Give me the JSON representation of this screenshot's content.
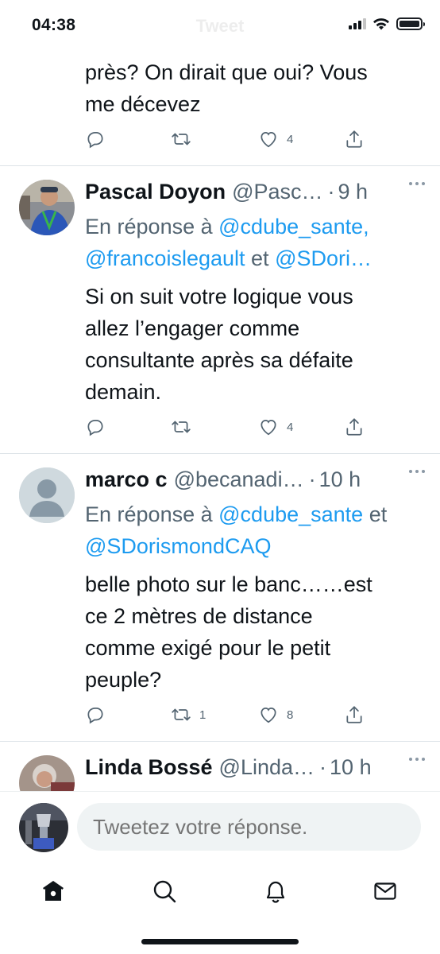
{
  "status_bar": {
    "time": "04:38",
    "ghost_title": "Tweet"
  },
  "previous_tweet": {
    "text_line1": "près? On dirait que oui? Vous",
    "text_line2": "me décevez",
    "actions": {
      "reply_count": "",
      "retweet_count": "",
      "like_count": "4"
    }
  },
  "tweets": [
    {
      "name": "Pascal Doyon",
      "handle": "@Pasc…",
      "time": "9 h",
      "reply_prefix": "En réponse à",
      "reply_mentions_line1": "@cdube_sante,",
      "reply_mentions_line2a": "@francoislegault",
      "reply_connector": "et",
      "reply_mentions_line2b": "@SDori…",
      "text_lines": [
        "Si on suit votre logique vous",
        "allez l’engager comme",
        "consultante après sa défaite",
        "demain."
      ],
      "actions": {
        "reply_count": "",
        "retweet_count": "",
        "like_count": "4"
      }
    },
    {
      "name": "marco c",
      "handle": "@becanadi…",
      "time": "10 h",
      "reply_prefix": "En réponse à",
      "reply_mentions_line1": "@cdube_sante",
      "reply_connector": "et",
      "reply_mentions_line2a": "@SDorismondCAQ",
      "text_lines": [
        "belle photo sur le banc……est",
        "ce 2 mètres de distance",
        "comme exigé pour le petit",
        "peuple?"
      ],
      "actions": {
        "reply_count": "",
        "retweet_count": "1",
        "like_count": "8"
      }
    },
    {
      "name": "Linda Bossé",
      "handle": "@Linda…",
      "time": "10 h"
    }
  ],
  "composer": {
    "placeholder": "Tweetez votre réponse."
  },
  "tabs": [
    "home-icon",
    "search-icon",
    "bell-icon",
    "mail-icon"
  ],
  "colors": {
    "accent": "#1d9bf0",
    "text": "#0f1419",
    "muted": "#536471"
  }
}
